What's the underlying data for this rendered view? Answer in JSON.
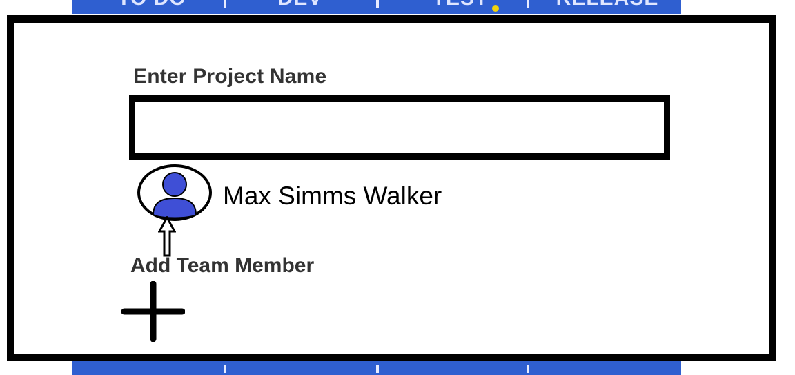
{
  "board": {
    "columns": [
      {
        "label": "TO DO"
      },
      {
        "label": "DEV"
      },
      {
        "label": "TEST"
      },
      {
        "label": "RELEASE"
      }
    ],
    "colors": {
      "strip": "#2f5fd0",
      "highlight": "#f2d40c"
    }
  },
  "dialog": {
    "project_label": "Enter Project Name",
    "project_input_value": "",
    "member": {
      "name": "Max Simms Walker",
      "avatar_color": "#3f4fd6",
      "icon": "user-avatar-icon"
    },
    "add_label": "Add Team Member",
    "add_icon": "plus-icon"
  }
}
